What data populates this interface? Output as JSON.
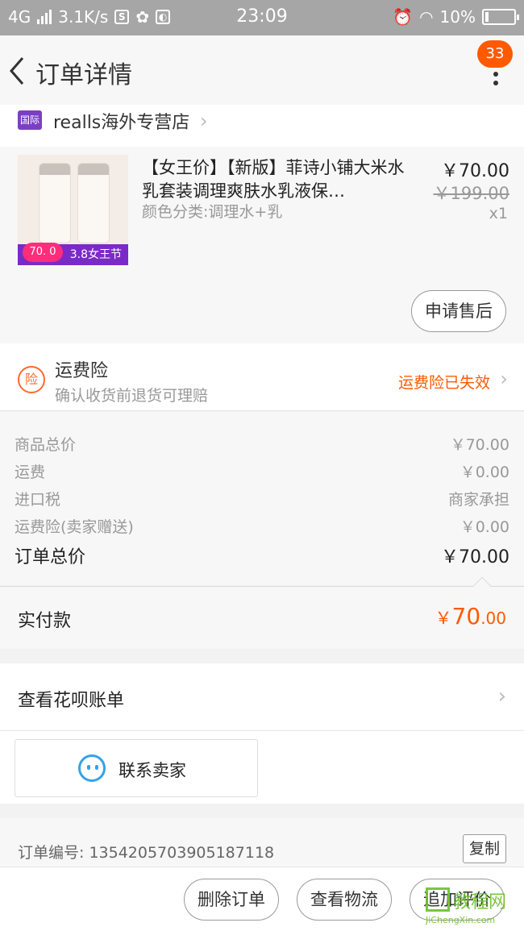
{
  "status_bar": {
    "network": "4G",
    "speed": "3.1K/s",
    "time": "23:09",
    "battery": "10%"
  },
  "header": {
    "title": "订单详情",
    "badge_count": "33"
  },
  "shop": {
    "tag": "国际",
    "name": "realls海外专营店"
  },
  "product": {
    "title": "【女王价】【新版】菲诗小铺大米水乳套装调理爽肤水乳液保…",
    "variant": "颜色分类:调理水+乳",
    "price": "￥70.00",
    "original_price": "￥199.00",
    "quantity": "x1",
    "thumb_promo": "3.8女王节",
    "thumb_price": "70. 0",
    "aftersale_label": "申请售后"
  },
  "insurance": {
    "icon_text": "险",
    "title": "运费险",
    "subtitle": "确认收货前退货可理赔",
    "status": "运费险已失效"
  },
  "costs": [
    {
      "label": "商品总价",
      "value": "￥70.00"
    },
    {
      "label": "运费",
      "value": "￥0.00"
    },
    {
      "label": "进口税",
      "value": "商家承担"
    },
    {
      "label": "运费险(卖家赠送)",
      "value": "￥0.00"
    }
  ],
  "order_total": {
    "label": "订单总价",
    "value": "￥70.00"
  },
  "paid": {
    "label": "实付款",
    "currency": "￥",
    "amount_main": "70",
    "amount_decimal": ".00"
  },
  "huabei": {
    "label": "查看花呗账单"
  },
  "contact": {
    "label": "联系卖家"
  },
  "order": {
    "number_text": "订单编号: 1354205703905187118",
    "copy_label": "复制"
  },
  "bottom_actions": {
    "delete": "删除订单",
    "logistics": "查看物流",
    "review": "追加评价"
  },
  "watermark": {
    "cn": "教程网",
    "en": "JiChengXin.com"
  },
  "colors": {
    "accent": "#ff5a00",
    "status_bar": "#a6a6a6",
    "contact_icon": "#35a2e8"
  }
}
